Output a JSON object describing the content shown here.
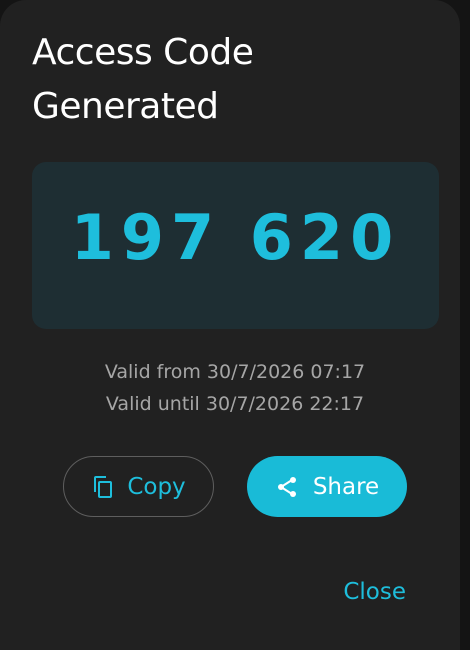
{
  "dialog": {
    "title": "Access Code Generated",
    "code": "197 620",
    "valid_from": "Valid from 30/7/2026 07:17",
    "valid_until": "Valid until 30/7/2026 22:17"
  },
  "actions": {
    "copy_label": "Copy",
    "copy_icon": "copy-icon",
    "share_label": "Share",
    "share_icon": "share-icon",
    "close_label": "Close"
  },
  "colors": {
    "background": "#212121",
    "accent": "#1ebedc",
    "code_box": "#1e2e33",
    "muted_text": "#a6a6a6"
  }
}
